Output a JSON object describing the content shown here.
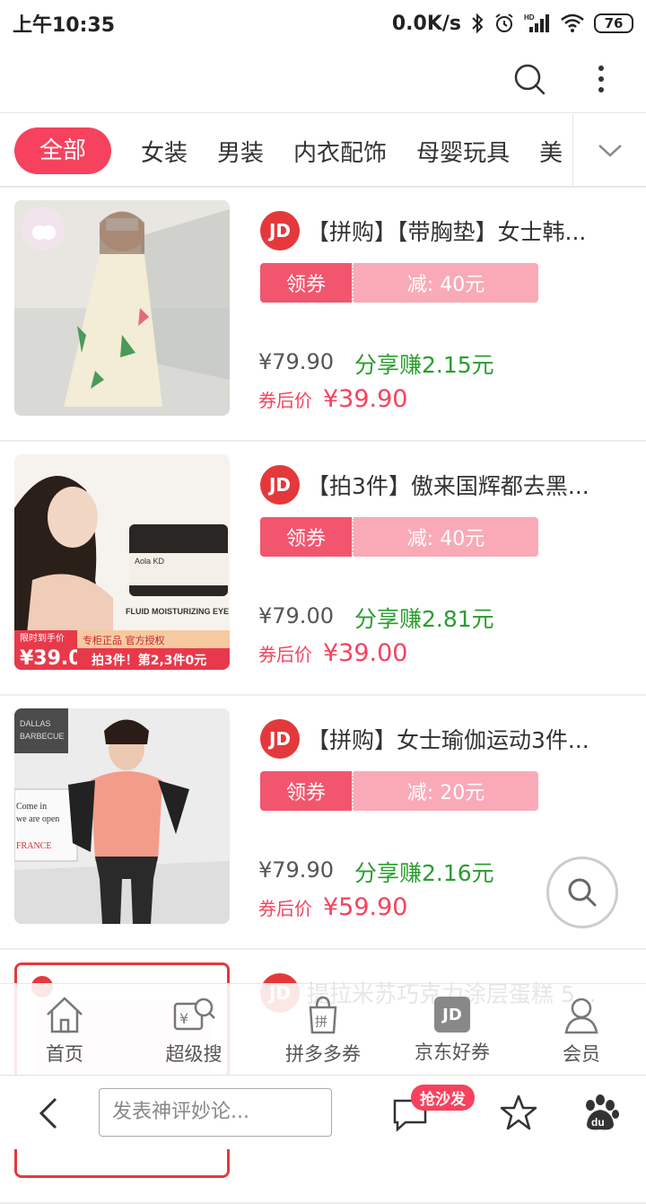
{
  "status_bar": {
    "time": "上午10:35",
    "net_speed": "0.0K/s",
    "battery": "76"
  },
  "categories": {
    "items": [
      "全部",
      "女装",
      "男装",
      "内衣配饰",
      "母婴玩具",
      "美"
    ],
    "active_index": 0
  },
  "products": [
    {
      "brand": "JD",
      "title": "【拼购】【带胸垫】女士韩...",
      "coupon_label": "领券",
      "coupon_value": "减: 40元",
      "price": "¥79.90",
      "share": "分享赚2.15元",
      "after_label": "券后价",
      "after_price": "¥39.90"
    },
    {
      "brand": "JD",
      "title": "【拍3件】傲来国辉都去黑...",
      "coupon_label": "领券",
      "coupon_value": "减: 40元",
      "price": "¥79.00",
      "share": "分享赚2.81元",
      "after_label": "券后价",
      "after_price": "¥39.00",
      "thumb_text": {
        "brand_name": "Aola KD",
        "product_name": "FLUID MOISTURIZING EYE CREAM",
        "limit": "限时到手价",
        "limit_price": "¥39.0",
        "genuine": "专柜正品 官方授权",
        "promo": "拍3件！第2,3件0元"
      }
    },
    {
      "brand": "JD",
      "title": "【拼购】女士瑜伽运动3件...",
      "coupon_label": "领券",
      "coupon_value": "减: 20元",
      "price": "¥79.90",
      "share": "分享赚2.16元",
      "after_label": "券后价",
      "after_price": "¥59.90",
      "thumb_text": {
        "sign1": "DALLAS",
        "sign2": "BARBECUE",
        "sign3": "Come in",
        "sign4": "we are open",
        "sign5": "FRANCE"
      }
    },
    {
      "brand": "JD",
      "title": "提拉米苏巧克力涂层蛋糕 5..."
    }
  ],
  "tabbar": [
    {
      "label": "首页",
      "icon": "home-icon"
    },
    {
      "label": "超级搜",
      "icon": "super-search-icon"
    },
    {
      "label": "拼多多券",
      "icon": "pdd-bag-icon"
    },
    {
      "label": "京东好券",
      "icon": "jd-icon",
      "icon_text": "JD"
    },
    {
      "label": "会员",
      "icon": "member-icon"
    }
  ],
  "bottom": {
    "comment_placeholder": "发表神评妙论...",
    "badge": "抢沙发"
  },
  "colors": {
    "accent": "#f6425e",
    "green": "#2a9d2f",
    "coupon_light": "#f9aab6"
  }
}
